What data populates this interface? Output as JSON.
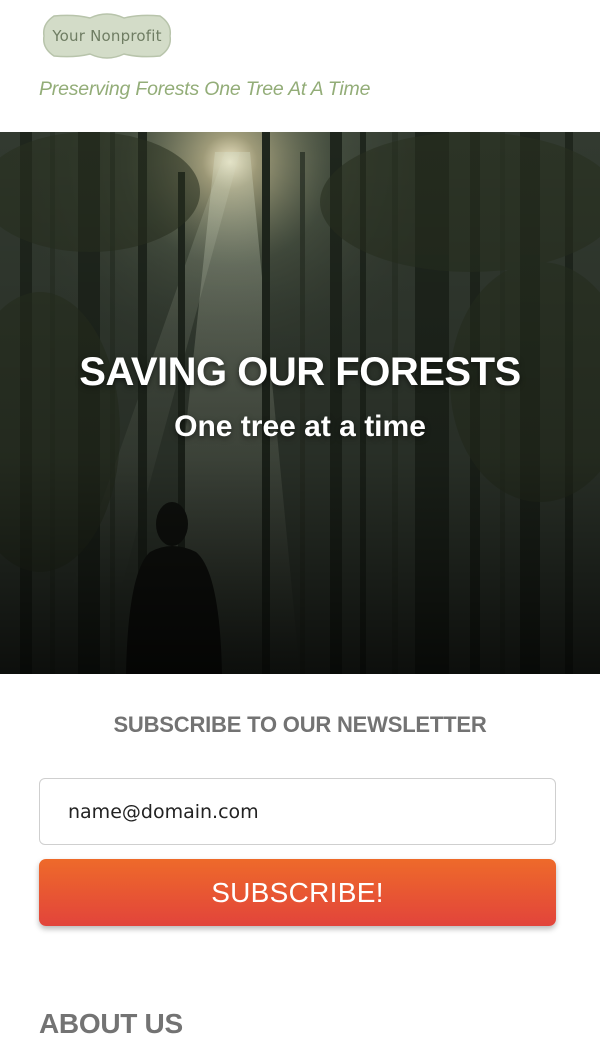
{
  "header": {
    "logo_text": "Your Nonprofit",
    "tagline": "Preserving Forests One Tree At A Time"
  },
  "hero": {
    "title": "SAVING OUR FORESTS",
    "subtitle": "One tree at a time",
    "image_subject": "forest-with-hooded-person-and-sunlight"
  },
  "newsletter": {
    "heading": "SUBSCRIBE TO OUR NEWSLETTER",
    "email_placeholder": "name@domain.com",
    "button_label": "SUBSCRIBE!"
  },
  "about": {
    "heading": "ABOUT US"
  },
  "colors": {
    "tagline": "#93ad78",
    "logo_fill": "#d3dcc8",
    "button_top": "#ee6a2a",
    "button_bottom": "#e2443b",
    "heading_gray": "#737373"
  }
}
